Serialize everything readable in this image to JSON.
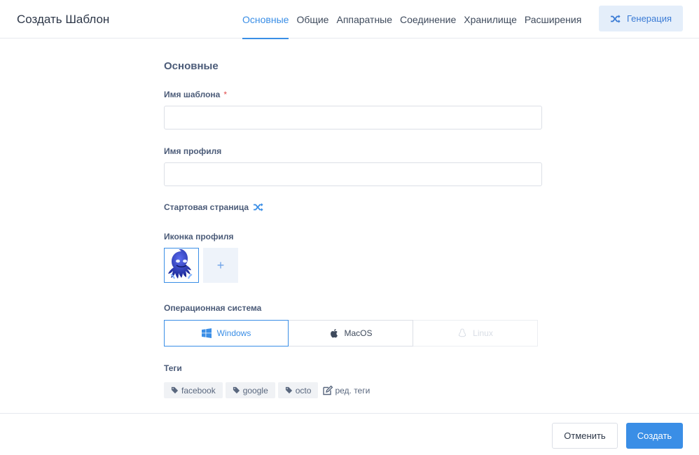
{
  "header": {
    "title": "Создать Шаблон",
    "tabs": [
      {
        "label": "Основные",
        "active": true
      },
      {
        "label": "Общие"
      },
      {
        "label": "Аппаратные"
      },
      {
        "label": "Соединение"
      },
      {
        "label": "Хранилище"
      },
      {
        "label": "Расширения"
      }
    ],
    "generate_label": "Генерация",
    "generate_icon": "shuffle-icon"
  },
  "form": {
    "section_title": "Основные",
    "template_name": {
      "label": "Имя шаблона",
      "required_mark": "*",
      "value": ""
    },
    "profile_name": {
      "label": "Имя профиля",
      "value": ""
    },
    "start_page": {
      "label": "Стартовая страница",
      "icon": "shuffle-icon"
    },
    "profile_icon": {
      "label": "Иконка профиля",
      "add_label": "+"
    },
    "os": {
      "label": "Операционная система",
      "options": [
        {
          "label": "Windows",
          "icon": "windows-icon",
          "state": "selected"
        },
        {
          "label": "MacOS",
          "icon": "apple-icon",
          "state": "normal"
        },
        {
          "label": "Linux",
          "icon": "linux-icon",
          "state": "disabled"
        }
      ]
    },
    "tags": {
      "label": "Теги",
      "items": [
        "facebook",
        "google",
        "octo"
      ],
      "edit_label": "ред. теги"
    }
  },
  "footer": {
    "cancel_label": "Отменить",
    "create_label": "Создать"
  },
  "colors": {
    "accent": "#3a8ee6",
    "required": "#e04a4a",
    "generate_bg": "#e4eefa"
  }
}
